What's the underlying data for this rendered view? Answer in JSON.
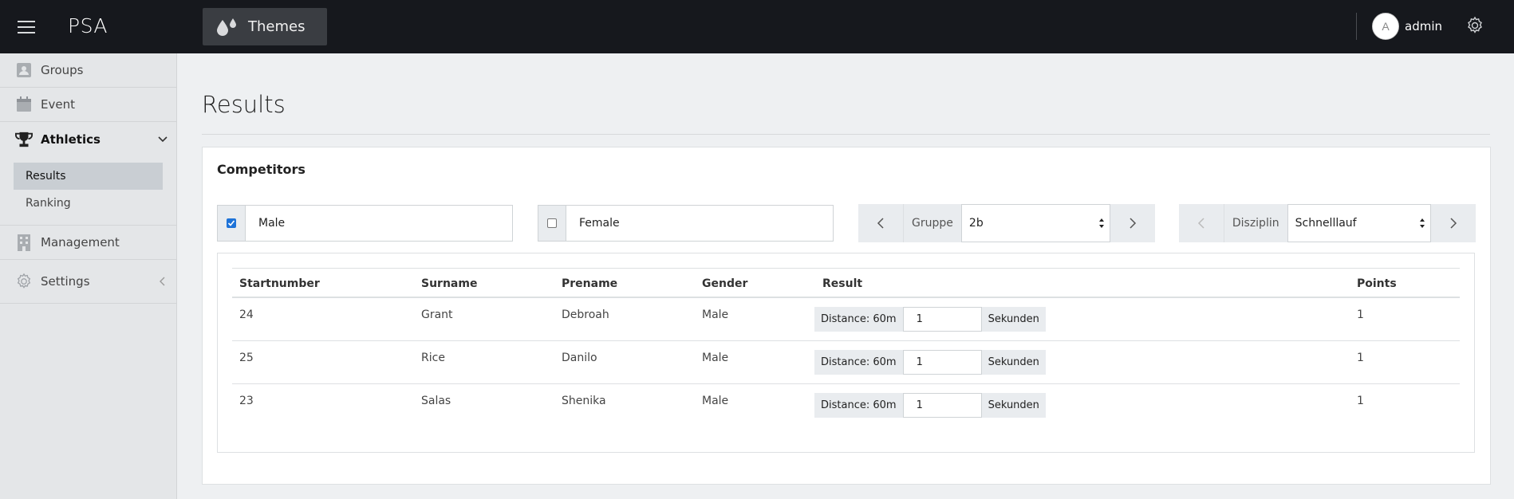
{
  "topbar": {
    "brand": "PSA",
    "themes_label": "Themes",
    "avatar_initial": "A",
    "username": "admin"
  },
  "sidebar": {
    "items": [
      {
        "label": "Groups",
        "icon": "groups-icon"
      },
      {
        "label": "Event",
        "icon": "calendar-icon"
      },
      {
        "label": "Athletics",
        "icon": "trophy-icon"
      },
      {
        "label": "Management",
        "icon": "building-icon"
      },
      {
        "label": "Settings",
        "icon": "gear-icon"
      }
    ],
    "subitems": [
      {
        "label": "Results"
      },
      {
        "label": "Ranking"
      }
    ]
  },
  "page": {
    "title": "Results"
  },
  "card": {
    "title": "Competitors",
    "filters": {
      "male": {
        "label": "Male",
        "checked": true
      },
      "female": {
        "label": "Female",
        "checked": false
      },
      "group": {
        "label": "Gruppe",
        "value": "2b"
      },
      "discipline": {
        "label": "Disziplin",
        "value": "Schnelllauf"
      }
    }
  },
  "table": {
    "headers": [
      "Startnumber",
      "Surname",
      "Prename",
      "Gender",
      "Result",
      "Points"
    ],
    "rows": [
      {
        "startnumber": "24",
        "surname": "Grant",
        "prename": "Debroah",
        "gender": "Male",
        "result_prefix": "Distance: 60m",
        "result_value": "1",
        "result_unit": "Sekunden",
        "points": "1"
      },
      {
        "startnumber": "25",
        "surname": "Rice",
        "prename": "Danilo",
        "gender": "Male",
        "result_prefix": "Distance: 60m",
        "result_value": "1",
        "result_unit": "Sekunden",
        "points": "1"
      },
      {
        "startnumber": "23",
        "surname": "Salas",
        "prename": "Shenika",
        "gender": "Male",
        "result_prefix": "Distance: 60m",
        "result_value": "1",
        "result_unit": "Sekunden",
        "points": "1"
      }
    ]
  },
  "colors": {
    "topbar": "#16181d",
    "sidebar": "#e4e6e8",
    "checkbox_accent": "#1e73d8",
    "background": "#eef0f2"
  }
}
